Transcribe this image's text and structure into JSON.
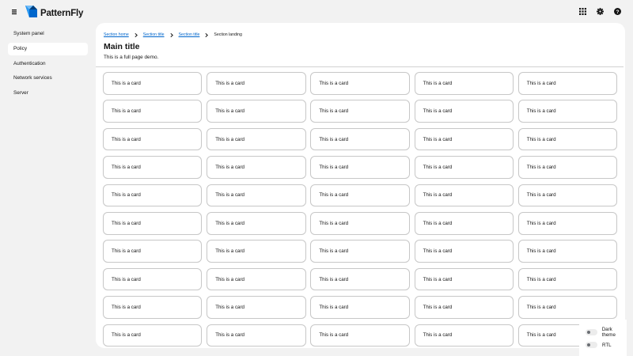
{
  "masthead": {
    "brand": "PatternFly",
    "menu_icon": "hamburger-icon",
    "tools": [
      {
        "icon": "grid-icon",
        "name": "apps"
      },
      {
        "icon": "gear-icon",
        "name": "settings"
      },
      {
        "icon": "help-icon",
        "name": "help"
      }
    ]
  },
  "sidebar": {
    "items": [
      {
        "label": "System panel",
        "active": false
      },
      {
        "label": "Policy",
        "active": true
      },
      {
        "label": "Authentication",
        "active": false
      },
      {
        "label": "Network services",
        "active": false
      },
      {
        "label": "Server",
        "active": false
      }
    ]
  },
  "breadcrumb": {
    "items": [
      "Section home",
      "Section title",
      "Section title"
    ],
    "current": "Section landing"
  },
  "page": {
    "title": "Main title",
    "description": "This is a full page demo."
  },
  "cards": {
    "label": "This is a card",
    "count": 50
  },
  "settings": {
    "dark_theme": "Dark theme",
    "rtl": "RTL"
  },
  "colors": {
    "background": "#f2f2f2",
    "link": "#0066cc",
    "brand_blue": "#0066cc"
  }
}
